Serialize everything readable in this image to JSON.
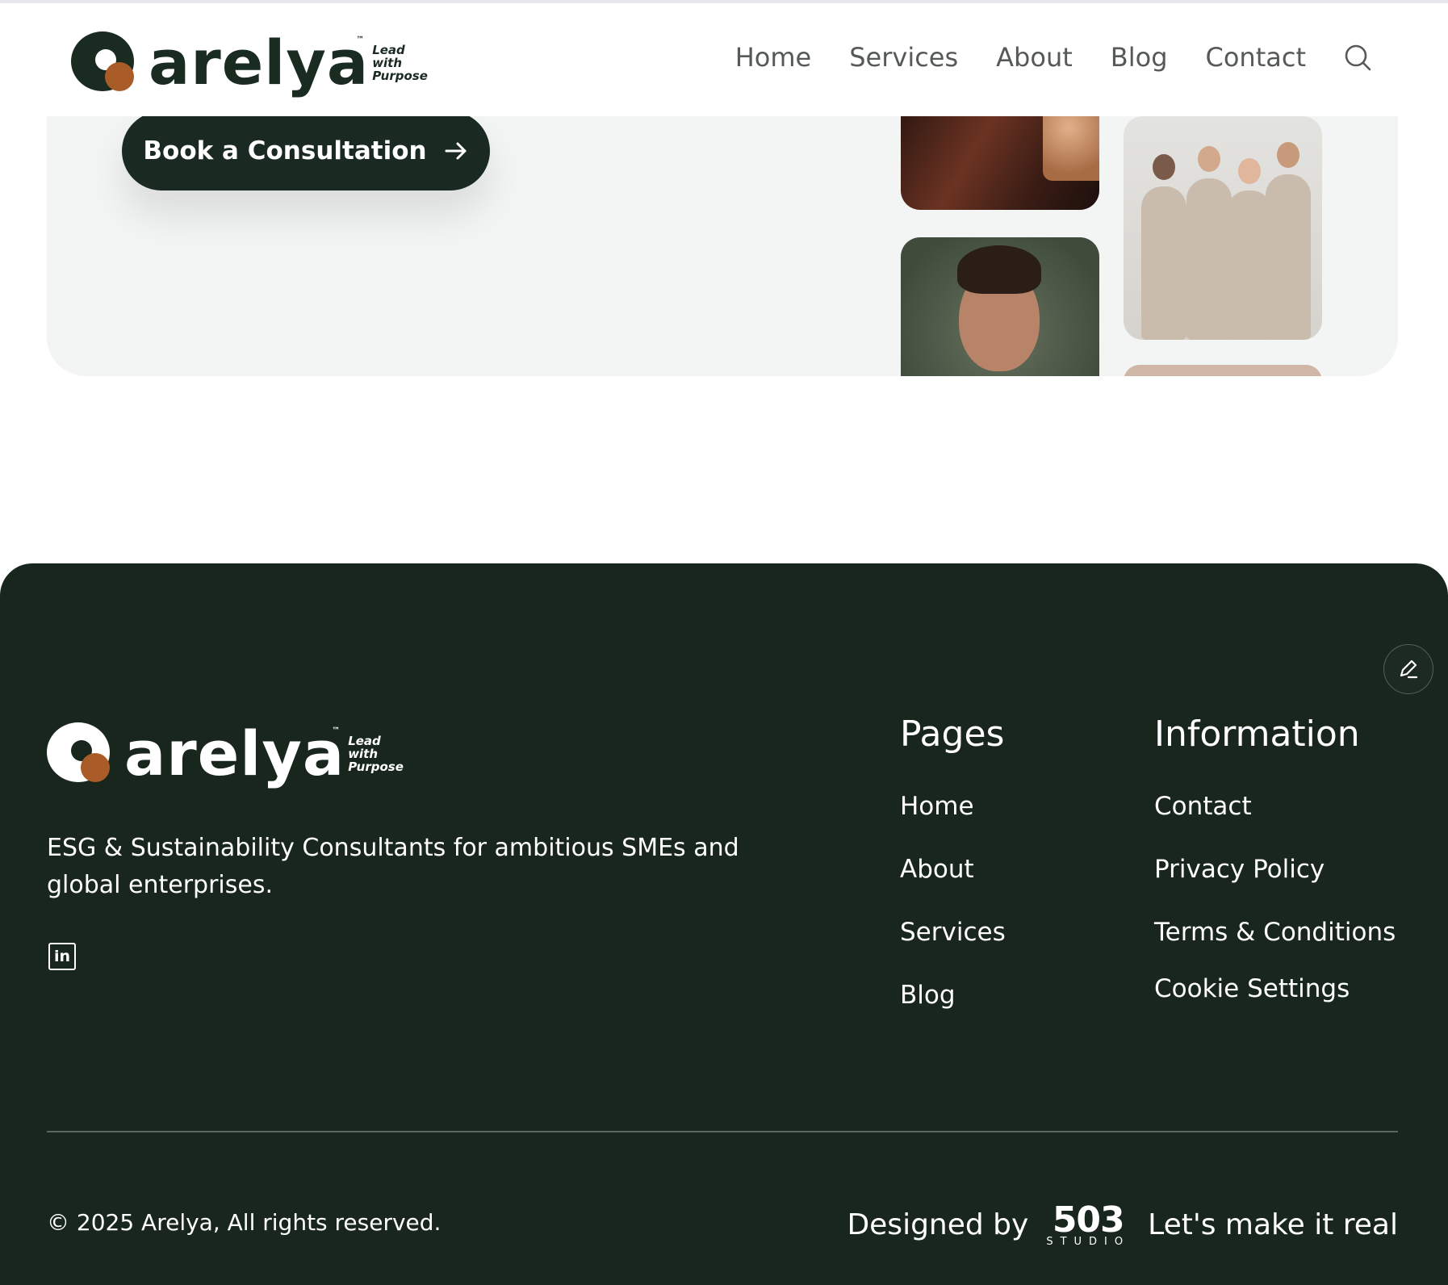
{
  "brand": {
    "name": "arelya",
    "tm": "™",
    "tagline_lines": [
      "Lead",
      "with",
      "Purpose"
    ]
  },
  "nav": {
    "items": [
      "Home",
      "Services",
      "About",
      "Blog",
      "Contact"
    ]
  },
  "hero": {
    "cta_label": "Book a Consultation"
  },
  "footer": {
    "description": "ESG & Sustainability Consultants for ambitious SMEs and global enterprises.",
    "pages": {
      "heading": "Pages",
      "links": [
        "Home",
        "About",
        "Services",
        "Blog"
      ]
    },
    "information": {
      "heading": "Information",
      "links": [
        "Contact",
        "Privacy Policy",
        "Terms & Conditions",
        "Cookie Settings"
      ]
    },
    "social_linkedin": "in",
    "copyright": "© 2025 Arelya, All rights reserved.",
    "designed_by": "Designed by",
    "studio_number": "503",
    "studio_word": "STUDIO",
    "studio_slogan": "Let's make it real"
  },
  "colors": {
    "brand_dark": "#18261e",
    "accent_copper": "#a95c27",
    "nav_text": "#555a58",
    "hero_bg": "#f3f5f4"
  },
  "icons": [
    "search-icon",
    "arrow-right-icon",
    "edit-pen-icon",
    "linkedin-icon"
  ]
}
